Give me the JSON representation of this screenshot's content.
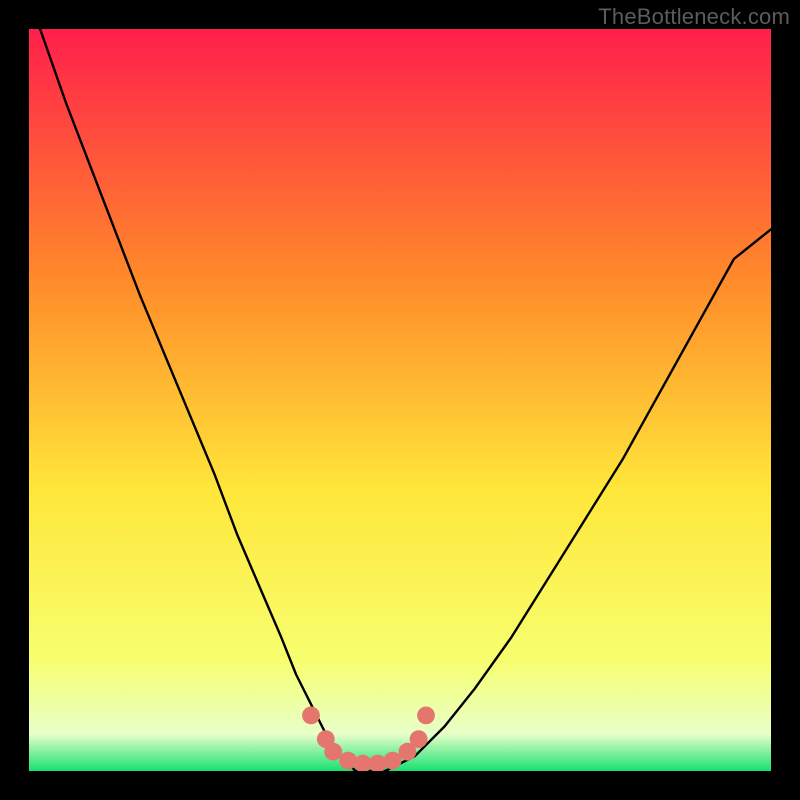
{
  "watermark": "TheBottleneck.com",
  "colors": {
    "gradient_top": "#ff1f4b",
    "gradient_upper_mid": "#ff8b2a",
    "gradient_mid": "#ffe63a",
    "gradient_lower": "#f7ff6f",
    "gradient_pale": "#e8ffc8",
    "gradient_bottom": "#18e072",
    "curve": "#000000",
    "nodule": "#e5766e"
  },
  "chart_data": {
    "type": "line",
    "title": "",
    "xlabel": "",
    "ylabel": "",
    "xlim": [
      0,
      100
    ],
    "ylim": [
      0,
      100
    ],
    "series": [
      {
        "name": "bottleneck-curve",
        "x": [
          1.5,
          5,
          10,
          15,
          20,
          25,
          28,
          31,
          34,
          36,
          38,
          40,
          42,
          44,
          48,
          52,
          56,
          60,
          65,
          70,
          75,
          80,
          85,
          90,
          95,
          100
        ],
        "values": [
          100,
          90,
          77,
          64,
          52,
          40,
          32,
          25,
          18,
          13,
          9,
          5,
          2,
          0,
          0,
          2,
          6,
          11,
          18,
          26,
          34,
          42,
          51,
          60,
          69,
          73
        ]
      }
    ],
    "nodule": {
      "x": [
        38,
        40,
        41,
        43,
        45,
        47,
        49,
        51,
        52.5,
        53.5
      ],
      "values": [
        7.5,
        4.3,
        2.6,
        1.4,
        1.0,
        1.0,
        1.4,
        2.6,
        4.3,
        7.5
      ],
      "radius_normalized": 1.2
    }
  }
}
